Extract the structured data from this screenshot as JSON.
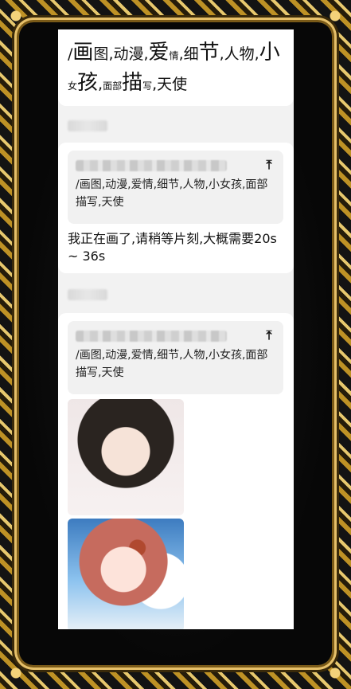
{
  "prompt_header": {
    "parts": [
      {
        "t": "/",
        "s": "n"
      },
      {
        "t": "画",
        "s": "lg"
      },
      {
        "t": "图",
        "s": "n"
      },
      {
        "t": ",动漫,",
        "s": "n"
      },
      {
        "t": "爱",
        "s": "lg"
      },
      {
        "t": "情",
        "s": "sm"
      },
      {
        "t": ",细",
        "s": "n"
      },
      {
        "t": "节",
        "s": "lg"
      },
      {
        "t": ",人物,",
        "s": "n"
      },
      {
        "t": "小",
        "s": "lg"
      },
      {
        "t": "女",
        "s": "sm"
      },
      {
        "t": "孩",
        "s": "lg"
      },
      {
        "t": ",",
        "s": "n"
      },
      {
        "t": "面部",
        "s": "sm"
      },
      {
        "t": "描",
        "s": "lg"
      },
      {
        "t": "写",
        "s": "sm"
      },
      {
        "t": ",天使",
        "s": "n"
      }
    ]
  },
  "messages": [
    {
      "quote_text": "/画图,动漫,爱情,细节,人物,小女孩,面部描写,天使",
      "reply_text": "我正在画了,请稍等片刻,大概需要20s ~ 36s"
    },
    {
      "quote_text": "/画图,动漫,爱情,细节,人物,小女孩,面部描写,天使"
    }
  ],
  "icons": {
    "quote_action": "arrow-up-to-top-icon"
  }
}
